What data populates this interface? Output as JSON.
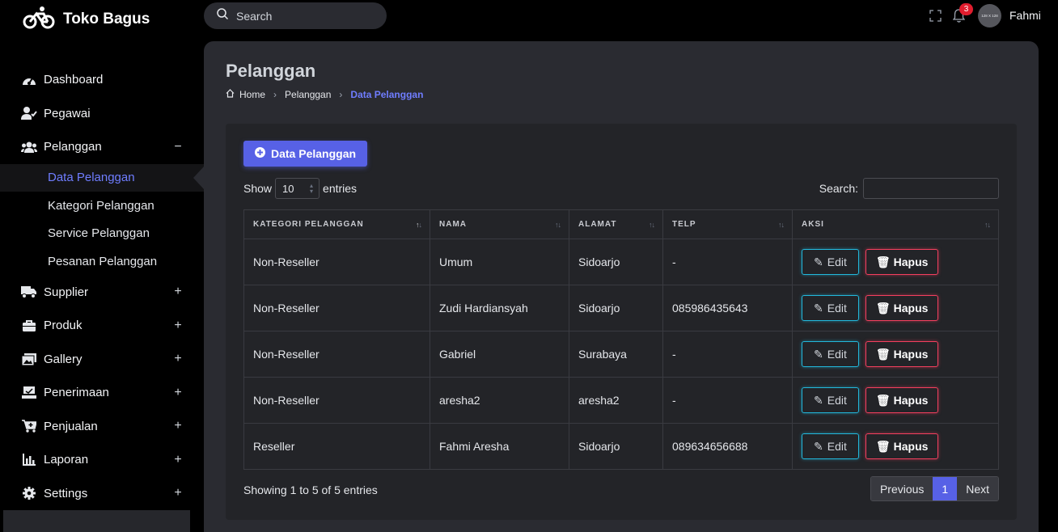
{
  "brand": {
    "title": "Toko Bagus"
  },
  "topbar": {
    "search_placeholder": "Search",
    "notification_count": "3",
    "avatar_text": "128 X 128",
    "user_name": "Fahmi"
  },
  "sidebar": {
    "items": [
      {
        "label": "Dashboard",
        "icon": "gauge-icon",
        "toggle": ""
      },
      {
        "label": "Pegawai",
        "icon": "user-check-icon",
        "toggle": ""
      },
      {
        "label": "Pelanggan",
        "icon": "users-icon",
        "toggle": "−"
      },
      {
        "label": "Supplier",
        "icon": "truck-icon",
        "toggle": "+"
      },
      {
        "label": "Produk",
        "icon": "briefcase-icon",
        "toggle": "+"
      },
      {
        "label": "Gallery",
        "icon": "images-icon",
        "toggle": "+"
      },
      {
        "label": "Penerimaan",
        "icon": "inbox-icon",
        "toggle": "+"
      },
      {
        "label": "Penjualan",
        "icon": "cart-icon",
        "toggle": "+"
      },
      {
        "label": "Laporan",
        "icon": "chart-icon",
        "toggle": "+"
      },
      {
        "label": "Settings",
        "icon": "gear-icon",
        "toggle": "+"
      }
    ],
    "subitems": [
      "Data Pelanggan",
      "Kategori Pelanggan",
      "Service Pelanggan",
      "Pesanan Pelanggan"
    ]
  },
  "page": {
    "title": "Pelanggan",
    "breadcrumb": [
      "Home",
      "Pelanggan",
      "Data Pelanggan"
    ]
  },
  "card": {
    "add_button": "Data Pelanggan",
    "show_label": "Show",
    "entries_value": "10",
    "entries_label": "entries",
    "search_label": "Search:",
    "columns": [
      "KATEGORI PELANGGAN",
      "NAMA",
      "ALAMAT",
      "TELP",
      "AKSI"
    ],
    "rows": [
      {
        "kategori": "Non-Reseller",
        "nama": "Umum",
        "alamat": "Sidoarjo",
        "telp": "-"
      },
      {
        "kategori": "Non-Reseller",
        "nama": "Zudi Hardiansyah",
        "alamat": "Sidoarjo",
        "telp": "085986435643"
      },
      {
        "kategori": "Non-Reseller",
        "nama": "Gabriel",
        "alamat": "Surabaya",
        "telp": "-"
      },
      {
        "kategori": "Non-Reseller",
        "nama": "aresha2",
        "alamat": "aresha2",
        "telp": "-"
      },
      {
        "kategori": "Reseller",
        "nama": "Fahmi Aresha",
        "alamat": "Sidoarjo",
        "telp": "089634656688"
      }
    ],
    "edit_label": "Edit",
    "delete_label": "Hapus",
    "info": "Showing 1 to 5 of 5 entries",
    "pager": {
      "previous": "Previous",
      "page": "1",
      "next": "Next"
    }
  },
  "colors": {
    "accent": "#5761e6",
    "active_link": "#6f7dff",
    "edit_border": "#22b8dc",
    "delete_border": "#f43f5e",
    "badge": "#e11d2e"
  }
}
